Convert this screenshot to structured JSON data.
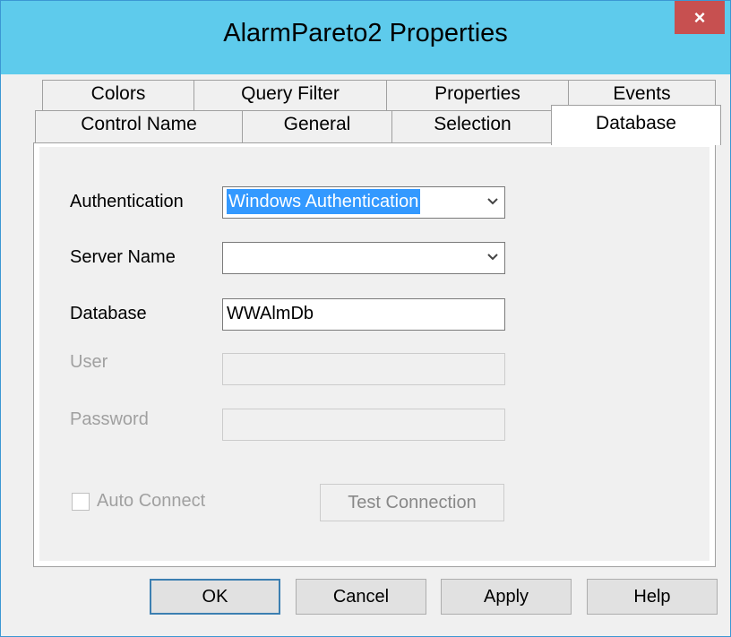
{
  "window": {
    "title": "AlarmPareto2 Properties",
    "close_glyph": "×"
  },
  "tabs_row1": [
    "Colors",
    "Query Filter",
    "Properties",
    "Events"
  ],
  "tabs_row2": [
    "Control Name",
    "General",
    "Selection",
    "Database"
  ],
  "active_tab": "Database",
  "form": {
    "authentication": {
      "label": "Authentication",
      "value": "Windows Authentication"
    },
    "server_name": {
      "label": "Server Name",
      "value": ""
    },
    "database": {
      "label": "Database",
      "value": "WWAlmDb"
    },
    "user": {
      "label": "User",
      "value": ""
    },
    "password": {
      "label": "Password",
      "value": ""
    },
    "auto_connect": {
      "label": "Auto Connect",
      "checked": false
    },
    "test_connection_label": "Test Connection"
  },
  "buttons": {
    "ok": "OK",
    "cancel": "Cancel",
    "apply": "Apply",
    "help": "Help"
  },
  "icons": {
    "dropdown": "chevron-down-icon",
    "close": "close-icon"
  },
  "colors": {
    "titlebar": "#5ecbec",
    "close": "#c75050",
    "selection": "#3399ff"
  }
}
